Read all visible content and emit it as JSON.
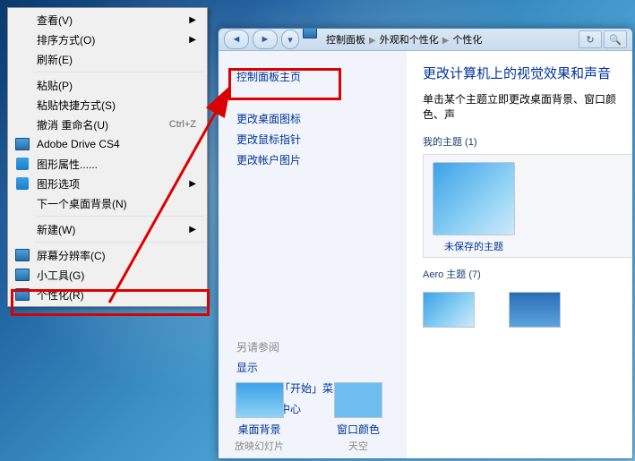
{
  "context_menu": {
    "items": [
      {
        "label": "查看(V)",
        "submenu": true
      },
      {
        "label": "排序方式(O)",
        "submenu": true
      },
      {
        "label": "刷新(E)"
      },
      {
        "sep": true
      },
      {
        "label": "粘贴(P)"
      },
      {
        "label": "粘贴快捷方式(S)"
      },
      {
        "label": "撤消 重命名(U)",
        "shortcut": "Ctrl+Z"
      },
      {
        "label": "Adobe Drive CS4",
        "icon": "blue"
      },
      {
        "label": "图形属性......",
        "icon": "sq"
      },
      {
        "label": "图形选项",
        "icon": "sq",
        "submenu": true
      },
      {
        "label": "下一个桌面背景(N)"
      },
      {
        "sep": true
      },
      {
        "label": "新建(W)",
        "submenu": true
      },
      {
        "sep": true
      },
      {
        "label": "屏幕分辨率(C)",
        "icon": "blue"
      },
      {
        "label": "小工具(G)",
        "icon": "blue"
      },
      {
        "label": "个性化(R)",
        "icon": "blue"
      }
    ]
  },
  "window": {
    "breadcrumb": [
      "控制面板",
      "外观和个性化",
      "个性化"
    ],
    "side": {
      "main": "控制面板主页",
      "links": [
        "更改桌面图标",
        "更改鼠标指针",
        "更改帐户图片"
      ],
      "see_also": "另请参阅",
      "see_links": [
        "显示",
        "任务栏和「开始」菜单",
        "轻松访问中心"
      ]
    },
    "content": {
      "title": "更改计算机上的视觉效果和声音",
      "desc": "单击某个主题立即更改桌面背景、窗口颜色、声",
      "group1": "我的主题 (1)",
      "unsaved": "未保存的主题",
      "group2": "Aero 主题 (7)",
      "footer": [
        {
          "t1": "桌面背景",
          "t2": "放映幻灯片"
        },
        {
          "t1": "窗口颜色",
          "t2": "天空"
        }
      ]
    }
  }
}
